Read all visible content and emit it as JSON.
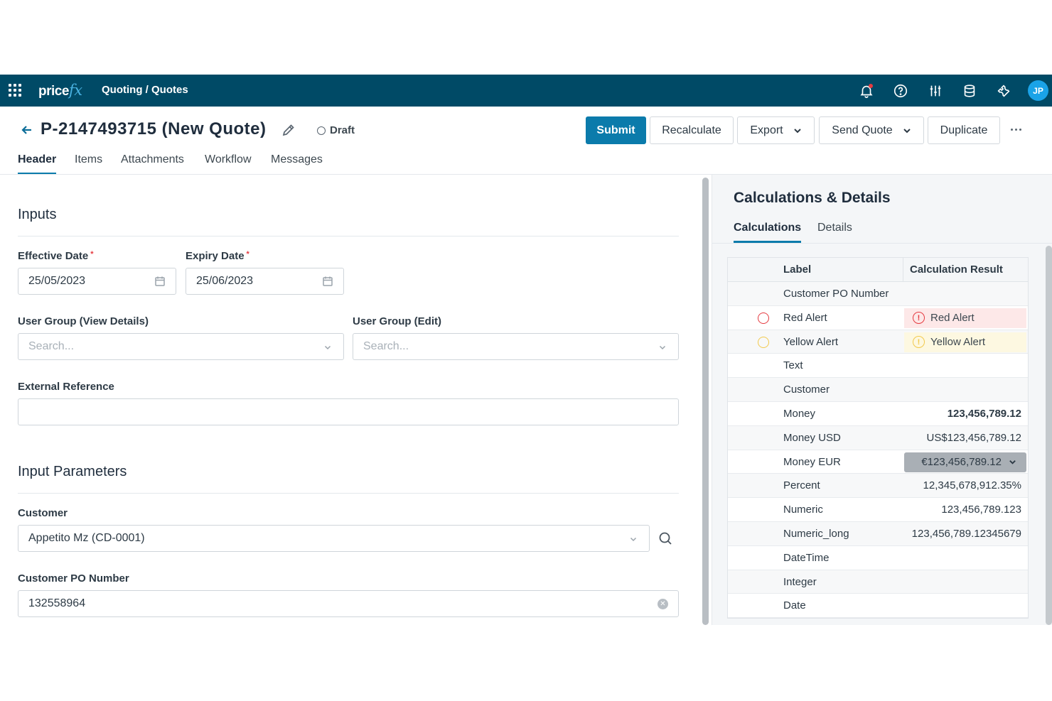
{
  "topbar": {
    "brand_main": "price",
    "brand_accent": "fx",
    "breadcrumb": "Quoting / Quotes",
    "avatar_initials": "JP",
    "icons": [
      "apps-grid-icon",
      "bell-icon",
      "help-icon",
      "sliders-icon",
      "database-icon",
      "tools-icon"
    ],
    "bg_color": "#004a66"
  },
  "quote": {
    "title": "P-2147493715 (New Quote)",
    "status": "Draft"
  },
  "actions": {
    "submit": "Submit",
    "recalculate": "Recalculate",
    "export": "Export",
    "send_quote": "Send Quote",
    "duplicate": "Duplicate"
  },
  "tabs": [
    "Header",
    "Items",
    "Attachments",
    "Workflow",
    "Messages"
  ],
  "active_tab": "Header",
  "inputs": {
    "section_title": "Inputs",
    "effective_date_label": "Effective Date",
    "effective_date_value": "25/05/2023",
    "expiry_date_label": "Expiry Date",
    "expiry_date_value": "25/06/2023",
    "required_mark": "*",
    "user_group_view_label": "User Group (View Details)",
    "user_group_view_placeholder": "Search...",
    "user_group_edit_label": "User Group (Edit)",
    "user_group_edit_placeholder": "Search...",
    "external_reference_label": "External Reference",
    "external_reference_value": ""
  },
  "input_parameters": {
    "section_title": "Input Parameters",
    "customer_label": "Customer",
    "customer_value": "Appetito Mz (CD-0001)",
    "customer_po_label": "Customer PO Number",
    "customer_po_value": "132558964"
  },
  "right_panel": {
    "title": "Calculations & Details",
    "tabs": [
      "Calculations",
      "Details"
    ],
    "active_tab": "Calculations",
    "columns": {
      "label": "Label",
      "result": "Calculation Result"
    },
    "rows": [
      {
        "label": "Customer PO Number",
        "value": ""
      },
      {
        "label": "Red Alert",
        "value": "Red Alert",
        "alert": "red"
      },
      {
        "label": "Yellow Alert",
        "value": "Yellow Alert",
        "alert": "yellow"
      },
      {
        "label": "Text",
        "value": ""
      },
      {
        "label": "Customer",
        "value": ""
      },
      {
        "label": "Money",
        "value": "123,456,789.12",
        "bold": true
      },
      {
        "label": "Money USD",
        "value": "US$123,456,789.12"
      },
      {
        "label": "Money EUR",
        "value": "€123,456,789.12",
        "select": true
      },
      {
        "label": "Percent",
        "value": "12,345,678,912.35%"
      },
      {
        "label": "Numeric",
        "value": "123,456,789.123"
      },
      {
        "label": "Numeric_long",
        "value": "123,456,789.12345679"
      },
      {
        "label": "DateTime",
        "value": ""
      },
      {
        "label": "Integer",
        "value": ""
      },
      {
        "label": "Date",
        "value": ""
      }
    ],
    "alert_colors": {
      "red": "#e53a40",
      "yellow": "#f2c94c"
    }
  }
}
